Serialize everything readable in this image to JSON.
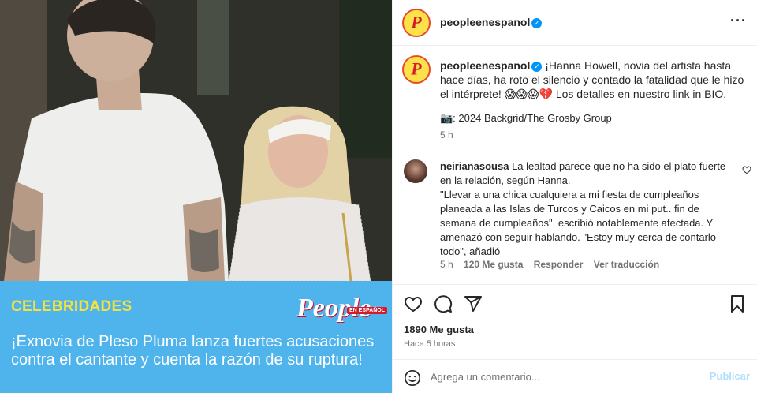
{
  "post": {
    "banner_category": "CELEBRIDADES",
    "brand_logo": "People",
    "brand_logo_tag": "EN ESPAÑOL",
    "headline": "¡Exnovia de Pleso Pluma lanza fuertes acusaciones contra el cantante y cuenta la razón de su ruptura!"
  },
  "header": {
    "username": "peopleenespanol",
    "verified_icon": "verified-badge-icon",
    "more_icon": "more-options-icon",
    "more_label": "···"
  },
  "caption": {
    "username": "peopleenespanol",
    "text": "¡Hanna Howell, novia del artista hasta hace días, ha roto el silencio y contado la fatalidad que le hizo el intérprete! 😱😱😱💔  Los detalles en nuestro link in BIO.",
    "credit": "📷: 2024 Backgrid/The Grosby Group",
    "time": "5 h"
  },
  "comment": {
    "username": "neirianasousa",
    "text": "La lealtad parece que no ha sido el plato fuerte en la relación, según Hanna.\n\"Llevar a una chica cualquiera a mi fiesta de cumpleaños planeada a las Islas de Turcos y Caicos en mi put.. fin de semana de cumpleaños\", escribió notablemente afectada. Y amenazó con seguir hablando. \"Estoy muy cerca de contarlo todo\", añadió",
    "time": "5 h",
    "likes": "120 Me gusta",
    "reply_label": "Responder",
    "translate_label": "Ver traducción",
    "like_icon": "heart-outline-icon"
  },
  "actions": {
    "icons": [
      "heart-icon",
      "comment-icon",
      "share-icon",
      "bookmark-icon"
    ]
  },
  "likes": "1890 Me gusta",
  "posted": "Hace 5 horas",
  "add_comment": {
    "placeholder": "Agrega un comentario...",
    "publish_label": "Publicar",
    "emoji_icon": "emoji-icon"
  },
  "colors": {
    "banner": "#4fb3ec",
    "category": "#f7e13b",
    "verified": "#0095f6",
    "publish": "#b2dffc",
    "muted": "#737373"
  }
}
